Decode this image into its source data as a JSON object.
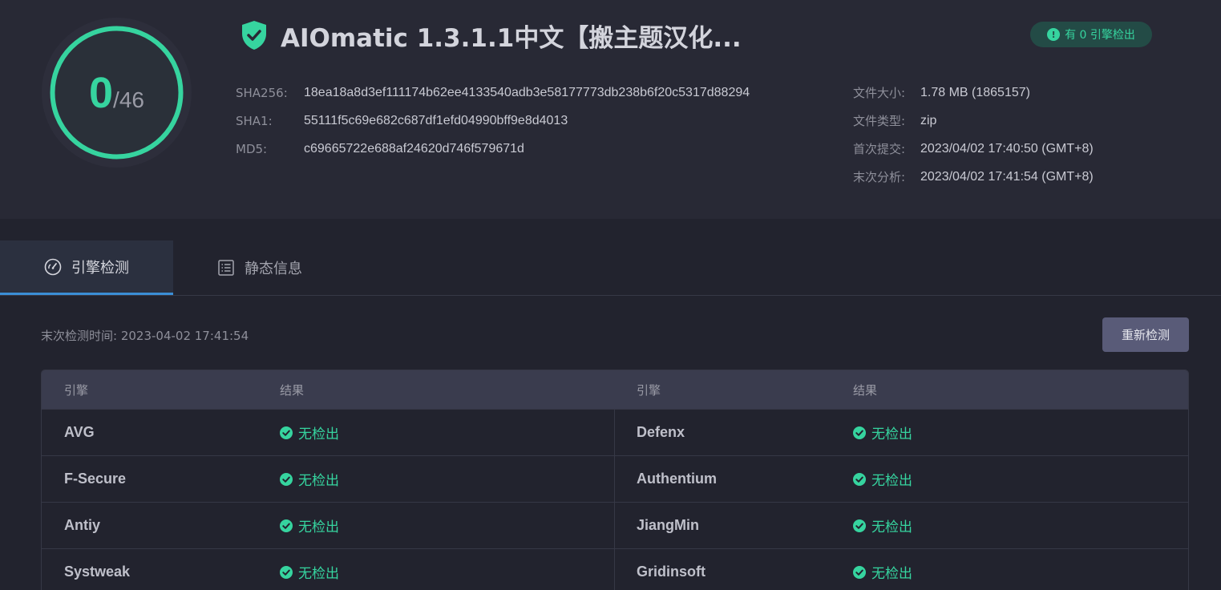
{
  "score": {
    "detected": "0",
    "total": "/46",
    "ring_color": "#36d49f"
  },
  "file": {
    "title": "AIOmatic 1.3.1.1中文【搬主题汉化..."
  },
  "badge": {
    "text": "有 0 引擎检出",
    "icon": "exclamation-circle-icon"
  },
  "hashes": [
    {
      "label": "SHA256:",
      "value": "18ea18a8d3ef111174b62ee4133540adb3e58177773db238b6f20c5317d88294"
    },
    {
      "label": "SHA1:",
      "value": "55111f5c69e682c687df1efd04990bff9e8d4013"
    },
    {
      "label": "MD5:",
      "value": "c69665722e688af24620d746f579671d"
    }
  ],
  "meta": [
    {
      "label": "文件大小:",
      "value": "1.78 MB (1865157)"
    },
    {
      "label": "文件类型:",
      "value": "zip"
    },
    {
      "label": "首次提交:",
      "value": "2023/04/02 17:40:50 (GMT+8)"
    },
    {
      "label": "末次分析:",
      "value": "2023/04/02 17:41:54 (GMT+8)"
    }
  ],
  "tabs": [
    {
      "label": "引擎检测",
      "icon": "gauge-icon",
      "active": true
    },
    {
      "label": "静态信息",
      "icon": "document-list-icon",
      "active": false
    }
  ],
  "last_check": "末次检测时间: 2023-04-02 17:41:54",
  "recheck_label": "重新检测",
  "table": {
    "headers": [
      "引擎",
      "结果",
      "引擎",
      "结果"
    ],
    "rows": [
      {
        "left_engine": "AVG",
        "left_result": "无检出",
        "right_engine": "Defenx",
        "right_result": "无检出"
      },
      {
        "left_engine": "F-Secure",
        "left_result": "无检出",
        "right_engine": "Authentium",
        "right_result": "无检出"
      },
      {
        "left_engine": "Antiy",
        "left_result": "无检出",
        "right_engine": "JiangMin",
        "right_result": "无检出"
      },
      {
        "left_engine": "Systweak",
        "left_result": "无检出",
        "right_engine": "Gridinsoft",
        "right_result": "无检出"
      }
    ]
  },
  "colors": {
    "accent_green": "#36d49f",
    "tab_underline": "#3b8ed6",
    "button_bg": "#595b78"
  }
}
